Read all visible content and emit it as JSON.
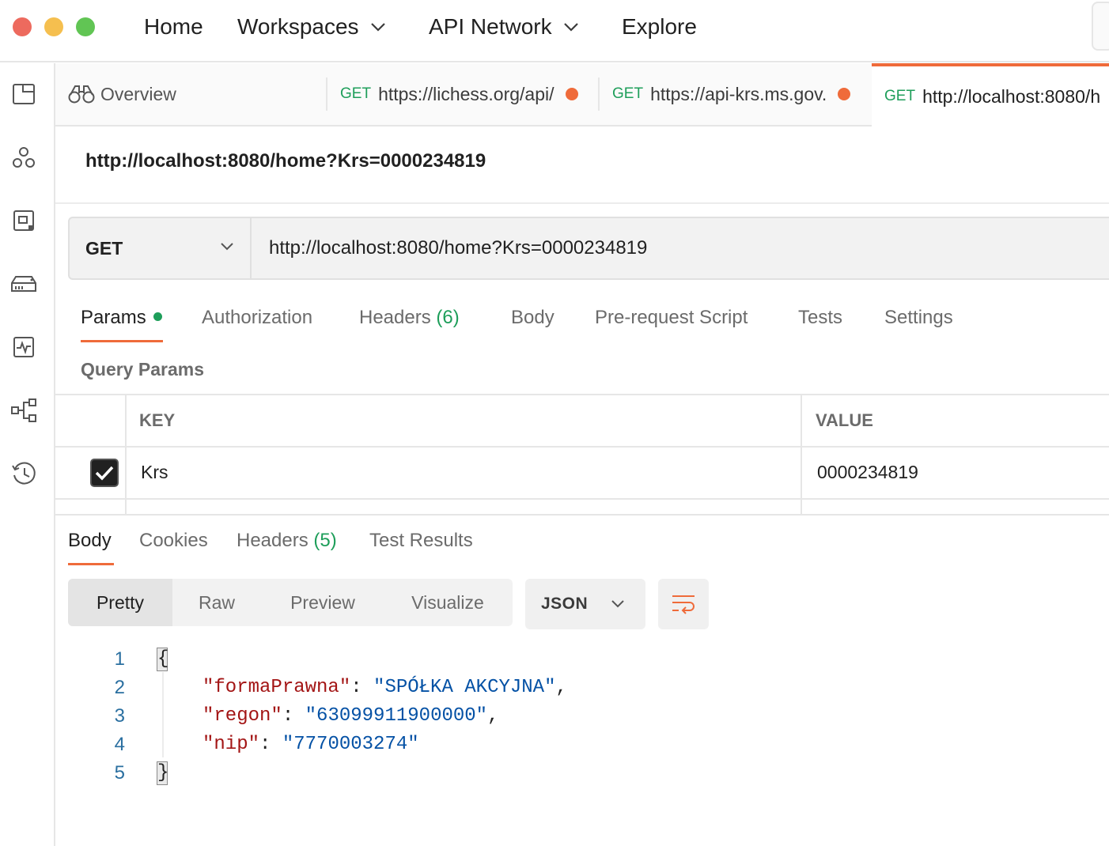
{
  "topnav": {
    "home": "Home",
    "workspaces": "Workspaces",
    "api_network": "API Network",
    "explore": "Explore"
  },
  "sidebar": {
    "icons": [
      "collections-icon",
      "apis-icon",
      "environments-icon",
      "mock-servers-icon",
      "monitors-icon",
      "flows-icon",
      "history-icon"
    ]
  },
  "tabs": [
    {
      "label": "Overview"
    },
    {
      "method": "GET",
      "url": "https://lichess.org/api/"
    },
    {
      "method": "GET",
      "url": "https://api-krs.ms.gov."
    },
    {
      "method": "GET",
      "url": "http://localhost:8080/h"
    }
  ],
  "request": {
    "title": "http://localhost:8080/home?Krs=0000234819",
    "method": "GET",
    "url": "http://localhost:8080/home?Krs=0000234819"
  },
  "request_tabs": {
    "params": "Params",
    "authorization": "Authorization",
    "headers": "Headers",
    "headers_count": "(6)",
    "body": "Body",
    "prerequest": "Pre-request Script",
    "tests": "Tests",
    "settings": "Settings"
  },
  "query_params": {
    "title": "Query Params",
    "columns": {
      "key": "KEY",
      "value": "VALUE"
    },
    "rows": [
      {
        "key": "Krs",
        "value": "0000234819",
        "checked": true
      }
    ]
  },
  "response_tabs": {
    "body": "Body",
    "cookies": "Cookies",
    "headers": "Headers",
    "headers_count": "(5)",
    "test_results": "Test Results"
  },
  "view_modes": [
    "Pretty",
    "Raw",
    "Preview",
    "Visualize"
  ],
  "format": "JSON",
  "code": {
    "line_numbers": [
      "1",
      "2",
      "3",
      "4",
      "5"
    ],
    "open_brace": "{",
    "close_brace": "}",
    "entries": [
      {
        "key": "\"formaPrawna\"",
        "value": "\"SPÓŁKA AKCYJNA\"",
        "trail": ","
      },
      {
        "key": "\"regon\"",
        "value": "\"63099911900000\"",
        "trail": ","
      },
      {
        "key": "\"nip\"",
        "value": "\"7770003274\"",
        "trail": ""
      }
    ]
  },
  "colors": {
    "accent": "#ef6b3a",
    "method_green": "#1e9e5a",
    "json_key": "#a31515",
    "json_string": "#0451a5"
  }
}
